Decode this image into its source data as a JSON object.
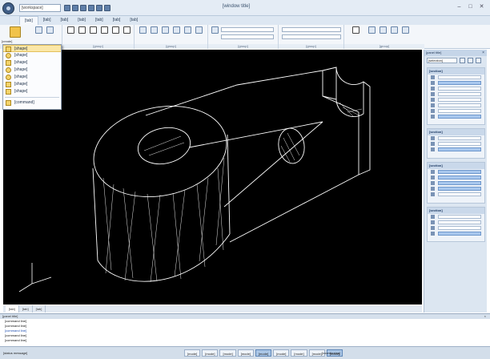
{
  "window": {
    "title": "[window title]",
    "workspace": "[workspace]",
    "controls": [
      "–",
      "□",
      "✕"
    ]
  },
  "ribbon": {
    "tabs": [
      {
        "label": "[tab]",
        "active": true
      },
      {
        "label": "[tab]",
        "active": false
      },
      {
        "label": "[tab]",
        "active": false
      },
      {
        "label": "[tab]",
        "active": false
      },
      {
        "label": "[tab]",
        "active": false
      },
      {
        "label": "[tab]",
        "active": false
      },
      {
        "label": "[tab]",
        "active": false
      }
    ],
    "create_button_label": "[create]",
    "group_labels": [
      "[group]",
      "[group]",
      "[group]",
      "[group]",
      "[group]",
      "[group]"
    ]
  },
  "shape_menu": {
    "items": [
      {
        "label": "[shape]",
        "selected": true
      },
      {
        "label": "[shape]",
        "selected": false
      },
      {
        "label": "[shape]",
        "selected": false
      },
      {
        "label": "[shape]",
        "selected": false
      },
      {
        "label": "[shape]",
        "selected": false
      },
      {
        "label": "[shape]",
        "selected": false
      },
      {
        "label": "[shape]",
        "selected": false
      }
    ],
    "footer": "[command]"
  },
  "layout_tabs": [
    {
      "label": "[tab]",
      "active": true
    },
    {
      "label": "[tab]",
      "active": false
    },
    {
      "label": "[tab]",
      "active": false
    }
  ],
  "properties": {
    "title": "[panel title]",
    "selector": "[selection]",
    "sections": [
      {
        "title": "[section]"
      },
      {
        "title": "[section]"
      },
      {
        "title": "[section]"
      },
      {
        "title": "[section]"
      }
    ]
  },
  "command": {
    "title": "[panel title]",
    "lines": [
      "[command line]",
      "[command line]",
      "[command line]",
      "[command line]",
      "[command line]"
    ]
  },
  "status": {
    "text": "[status message]",
    "toggles": [
      {
        "label": "[mode]",
        "on": false
      },
      {
        "label": "[mode]",
        "on": false
      },
      {
        "label": "[mode]",
        "on": false
      },
      {
        "label": "[mode]",
        "on": false
      },
      {
        "label": "[mode]",
        "on": true
      },
      {
        "label": "[mode]",
        "on": false
      },
      {
        "label": "[mode]",
        "on": false
      },
      {
        "label": "[mode]",
        "on": false
      },
      {
        "label": "[mode]",
        "on": true
      }
    ],
    "coordinates": "[coordinates]"
  },
  "colors": {
    "canvas": "#000000",
    "wireframe": "#ffffff",
    "menu_highlight": "#fbe7a7",
    "toggle_on": "#aac6e6"
  },
  "icons": {
    "app": "app-orb-icon",
    "shape": "solid-primitive-icon",
    "ucs": "ucs-axes-icon"
  }
}
